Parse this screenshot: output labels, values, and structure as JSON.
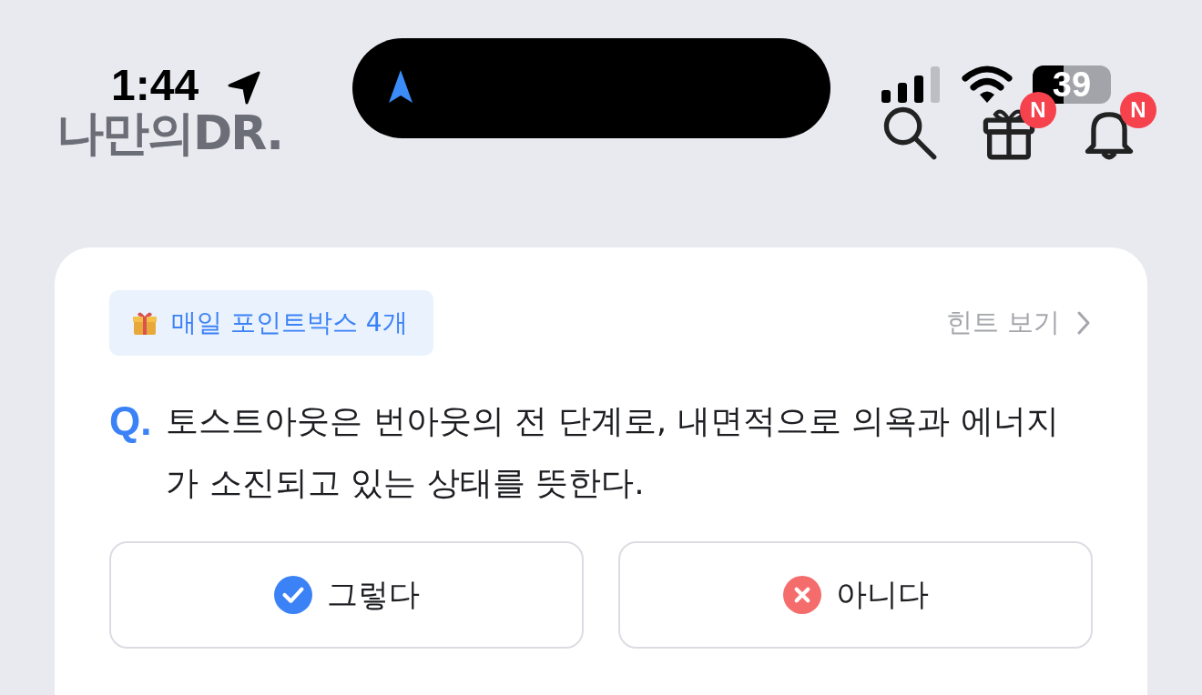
{
  "status_bar": {
    "time": "1:44",
    "battery": {
      "text": "39",
      "level": 0.39
    }
  },
  "header": {
    "logo": "나만의DR.",
    "icons": [
      {
        "kind": "search"
      },
      {
        "kind": "gift",
        "badge": "N"
      },
      {
        "kind": "bell",
        "badge": "N"
      }
    ]
  },
  "card": {
    "reward_chip": "매일 포인트박스 4개",
    "hint_link": "힌트 보기",
    "question": {
      "marker": "Q.",
      "text": "토스트아웃은 번아웃의 전 단계로, 내면적으로 의욕과 에너지가 소진되고 있는 상태를 뜻한다."
    },
    "answers": [
      {
        "kind": "yes",
        "label": "그렇다"
      },
      {
        "kind": "no",
        "label": "아니다"
      }
    ]
  }
}
